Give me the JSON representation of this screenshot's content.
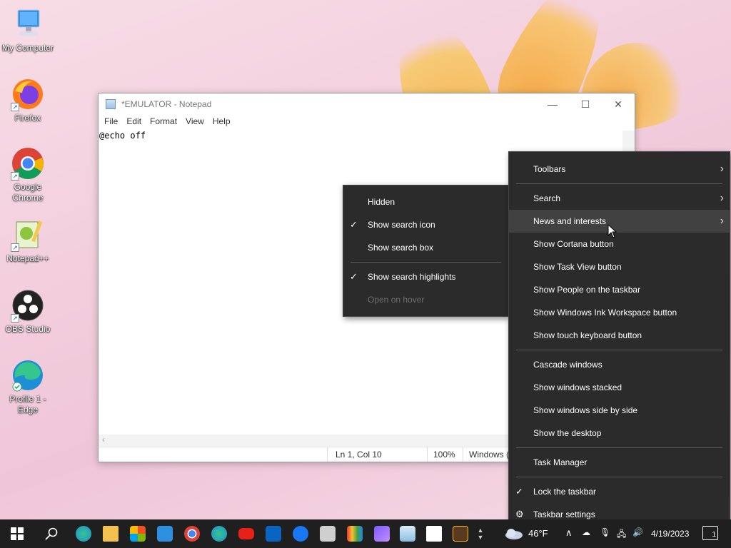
{
  "desktop": {
    "icons": [
      {
        "label": "My Computer"
      },
      {
        "label": "Firefox"
      },
      {
        "label": "Google Chrome"
      },
      {
        "label": "Notepad++"
      },
      {
        "label": "OBS Studio"
      },
      {
        "label": "Profile 1 - Edge"
      }
    ]
  },
  "notepad": {
    "title": "*EMULATOR - Notepad",
    "menu": [
      "File",
      "Edit",
      "Format",
      "View",
      "Help"
    ],
    "content": "@echo off",
    "status": {
      "position": "Ln 1, Col 10",
      "zoom": "100%",
      "line_ending": "Windows ("
    }
  },
  "search_submenu": {
    "items": [
      {
        "label": "Hidden",
        "checked": false,
        "disabled": false
      },
      {
        "label": "Show search icon",
        "checked": true,
        "disabled": false
      },
      {
        "label": "Show search box",
        "checked": false,
        "disabled": false
      },
      {
        "label": "Show search highlights",
        "checked": true,
        "disabled": false
      },
      {
        "label": "Open on hover",
        "checked": false,
        "disabled": true
      }
    ]
  },
  "taskbar_menu": {
    "items": [
      {
        "label": "Toolbars"
      },
      {
        "label": "Search"
      },
      {
        "label": "News and interests"
      },
      {
        "label": "Show Cortana button"
      },
      {
        "label": "Show Task View button"
      },
      {
        "label": "Show People on the taskbar"
      },
      {
        "label": "Show Windows Ink Workspace button"
      },
      {
        "label": "Show touch keyboard button"
      },
      {
        "label": "Cascade windows"
      },
      {
        "label": "Show windows stacked"
      },
      {
        "label": "Show windows side by side"
      },
      {
        "label": "Show the desktop"
      },
      {
        "label": "Task Manager"
      },
      {
        "label": "Lock the taskbar"
      },
      {
        "label": "Taskbar settings"
      }
    ]
  },
  "taskbar": {
    "weather": "46°F",
    "date": "4/19/2023",
    "notification_count": "1",
    "colors": {
      "background": "#1f1f1f",
      "menu": "#2b2b2b",
      "highlight": "#414141"
    }
  }
}
